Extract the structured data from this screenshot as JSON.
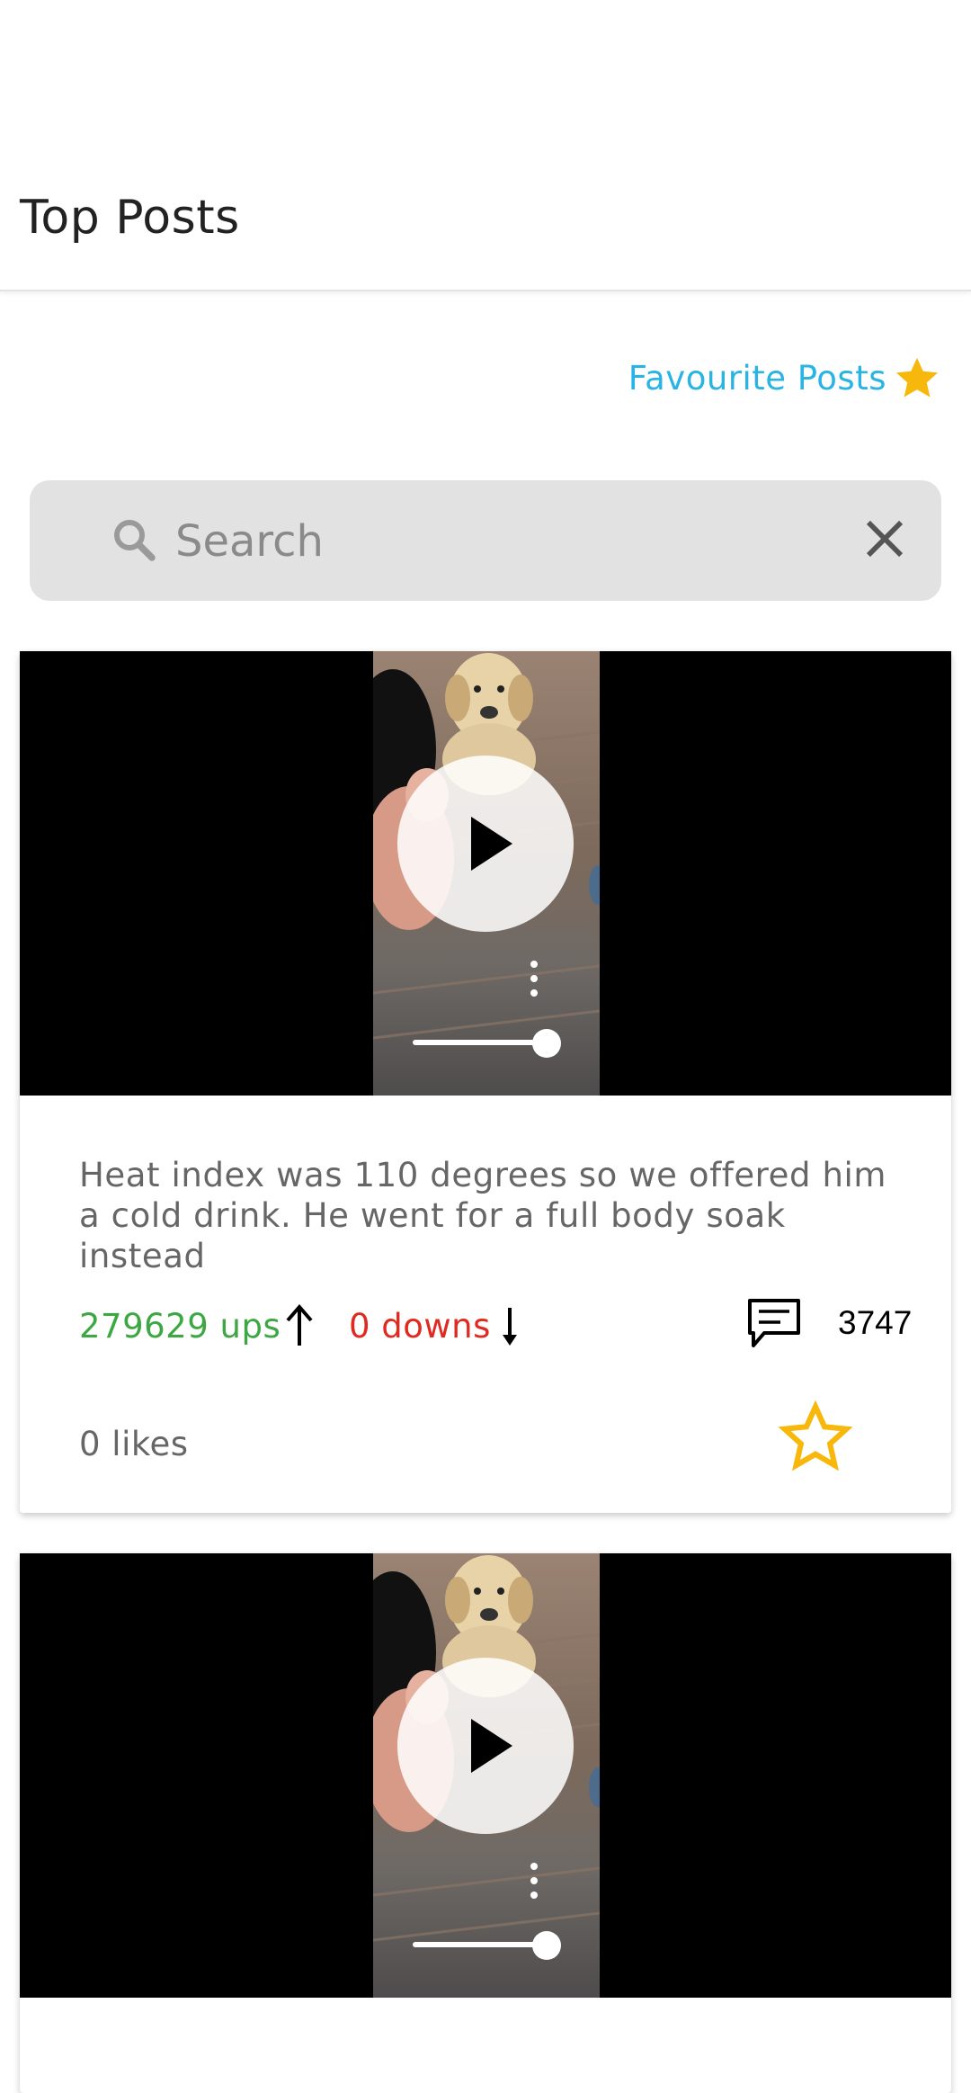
{
  "header": {
    "title": "Top Posts"
  },
  "favourites": {
    "label": "Favourite Posts",
    "icon": "star-filled-icon",
    "color": "#2ab4e3",
    "star_color": "#f8b70b"
  },
  "search": {
    "placeholder": "Search",
    "value": "",
    "icon": "search-icon",
    "clear_icon": "close-icon"
  },
  "posts": [
    {
      "caption": "Heat index was 110 degrees so we offered him a cold drink. He went for a full body soak instead",
      "ups_label": "279629 ups",
      "downs_label": "0 downs",
      "comments": "3747",
      "likes_label": "0 likes",
      "favourite": false,
      "ups_color": "#3da843",
      "downs_color": "#e02a1f"
    },
    {
      "caption": "",
      "favourite": false
    }
  ]
}
